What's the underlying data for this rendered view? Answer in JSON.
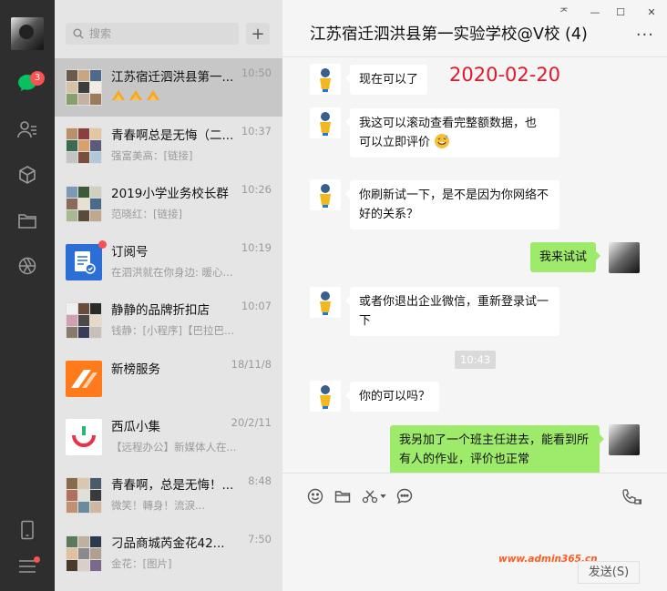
{
  "rail": {
    "badge_count": "3"
  },
  "search": {
    "placeholder": "搜索",
    "add_label": "+"
  },
  "chats": [
    {
      "name": "江苏宿迁泗洪县第一...",
      "time": "10:50",
      "preview": "",
      "active": true
    },
    {
      "name": "青春啊总是无悔（二...",
      "time": "10:37",
      "preview": "强富美高：[链接]"
    },
    {
      "name": "2019小学业务校长群",
      "time": "10:26",
      "preview": "范晓红：[链接]"
    },
    {
      "name": "订阅号",
      "time": "10:19",
      "preview": "在泗洪就在你身边: 暖心..."
    },
    {
      "name": "静静的品牌折扣店",
      "time": "10:07",
      "preview": "钱静：[小程序]【巴拉巴..."
    },
    {
      "name": "新榜服务",
      "time": "18/11/8",
      "preview": ""
    },
    {
      "name": "西瓜小集",
      "time": "20/2/11",
      "preview": "【远程办公】新媒体人在..."
    },
    {
      "name": "青春啊，总是无悔！...",
      "time": "8:48",
      "preview": "微笑！轉身！流淚..."
    },
    {
      "name": "刁品商城芮金花42...",
      "time": "7:50",
      "preview": "金花：[图片]"
    }
  ],
  "chat": {
    "title": "江苏宿迁泗洪县第一实验学校@V校 (4)",
    "date_stamp": "2020-02-20",
    "time_separator": "10:43",
    "messages": [
      {
        "from": "other",
        "text": "现在可以了"
      },
      {
        "from": "other",
        "text": "我这可以滚动查看完整额数据，也可以立即评价"
      },
      {
        "from": "other",
        "text": "你刷新试一下，是不是因为你网络不好的关系？"
      },
      {
        "from": "self",
        "text": "我来试试"
      },
      {
        "from": "other",
        "text": "或者你退出企业微信，重新登录试一下"
      },
      {
        "from": "other",
        "text": "你的可以吗？"
      },
      {
        "from": "self",
        "text": "我另加了一个班主任进去，能看到所有人的作业，评价也正常"
      }
    ]
  },
  "input": {
    "send_label": "发送(S)",
    "watermark": "www.admin365.cn"
  },
  "window": {
    "pin": "ᅎ",
    "minimize": "—",
    "maximize": "☐",
    "close": "✕",
    "more": "···"
  }
}
